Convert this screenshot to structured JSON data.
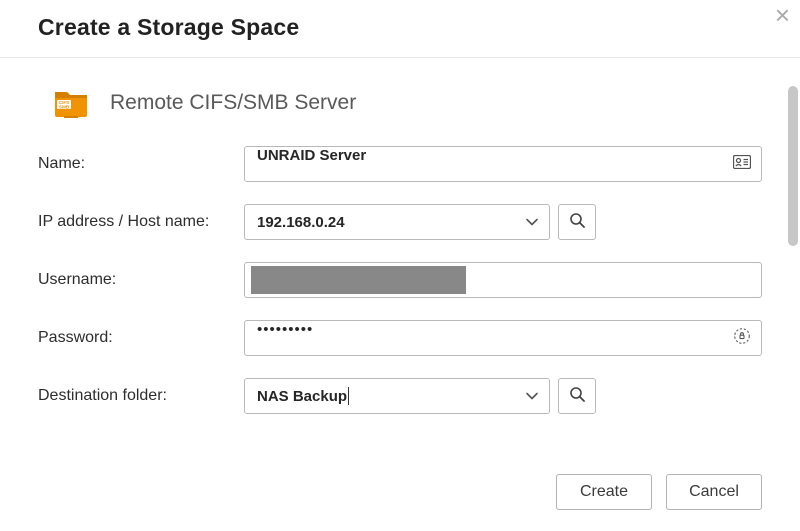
{
  "header": {
    "title": "Create a Storage Space"
  },
  "section": {
    "title": "Remote CIFS/SMB Server",
    "icon_tag": "CIFS SMB"
  },
  "form": {
    "name_label": "Name:",
    "name_value": "UNRAID Server",
    "ip_label": "IP address / Host name:",
    "ip_value": "192.168.0.24",
    "username_label": "Username:",
    "username_value": "",
    "password_label": "Password:",
    "password_value": "•••••••••",
    "dest_label": "Destination folder:",
    "dest_value": "NAS Backup"
  },
  "footer": {
    "create": "Create",
    "cancel": "Cancel"
  },
  "colors": {
    "accent": "#f19200"
  }
}
